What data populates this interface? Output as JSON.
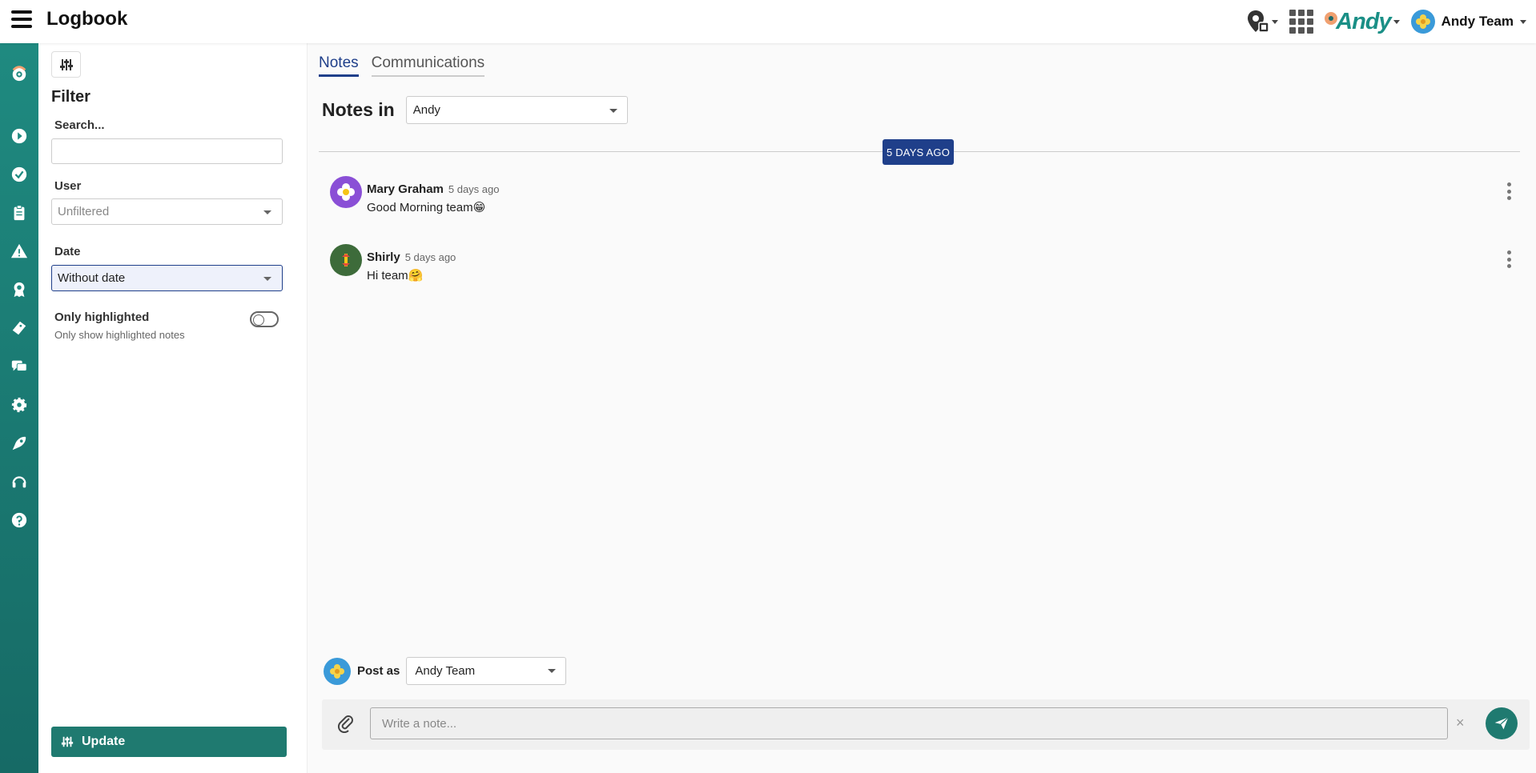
{
  "app": {
    "title": "Logbook"
  },
  "topbar": {
    "brand": "Andy",
    "team_name": "Andy Team",
    "icons": [
      "map-pin-icon",
      "apps-grid-icon"
    ]
  },
  "rail": {
    "items": [
      "logo-icon",
      "play-icon",
      "check-icon",
      "clipboard-icon",
      "warning-icon",
      "award-icon",
      "ticket-icon",
      "chat-icon",
      "settings-icon",
      "rocket-icon",
      "headset-icon",
      "help-icon"
    ]
  },
  "filter": {
    "title": "Filter",
    "search_label": "Search...",
    "search_value": "",
    "user_label": "User",
    "user_value": "Unfiltered",
    "date_label": "Date",
    "date_value": "Without date",
    "highlight_label": "Only highlighted",
    "highlight_help": "Only show highlighted notes",
    "highlight_on": false,
    "update_label": "Update"
  },
  "main": {
    "tabs": [
      {
        "label": "Notes",
        "active": true
      },
      {
        "label": "Communications",
        "active": false
      }
    ],
    "notes_in_label": "Notes in",
    "notes_in_value": "Andy",
    "date_badge": "5 DAYS AGO",
    "notes": [
      {
        "author": "Mary Graham",
        "time": "5 days ago",
        "text": "Good Morning team",
        "emoji": "😁",
        "avatar_color": "#8a4fd6"
      },
      {
        "author": "Shirly",
        "time": "5 days ago",
        "text": "Hi team",
        "emoji": "🤗",
        "avatar_color": "#3d6b3a"
      }
    ],
    "post_as_label": "Post as",
    "post_as_value": "Andy Team",
    "composer_placeholder": "Write a note...",
    "clear_symbol": "×"
  },
  "colors": {
    "rail": "#1f8a80",
    "accent_blue": "#1f3f8a",
    "update_green": "#1f7a70"
  }
}
